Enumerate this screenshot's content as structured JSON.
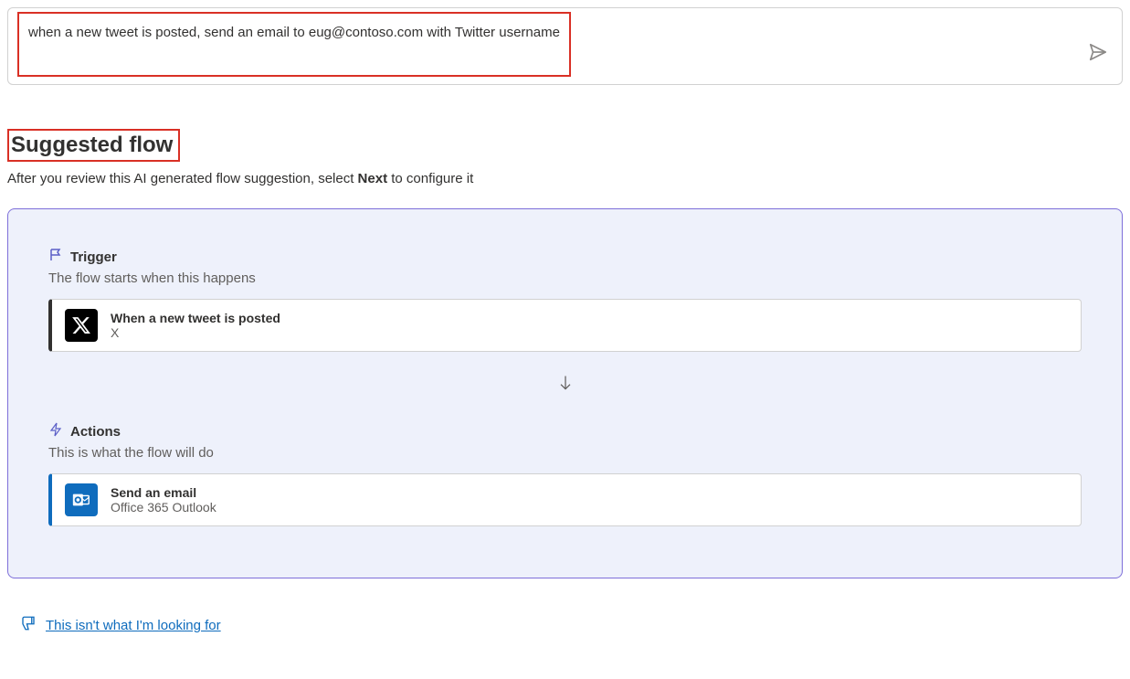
{
  "input": {
    "text": "when a new tweet is posted, send an email to eug@contoso.com with Twitter username"
  },
  "heading": "Suggested flow",
  "subheading_prefix": "After you review this AI generated flow suggestion, select ",
  "subheading_bold": "Next",
  "subheading_suffix": " to configure it",
  "trigger": {
    "label": "Trigger",
    "desc": "The flow starts when this happens",
    "step_title": "When a new tweet is posted",
    "step_sub": "X"
  },
  "actions": {
    "label": "Actions",
    "desc": "This is what the flow will do",
    "step_title": "Send an email",
    "step_sub": "Office 365 Outlook"
  },
  "feedback": {
    "link": "This isn't what I'm looking for"
  }
}
